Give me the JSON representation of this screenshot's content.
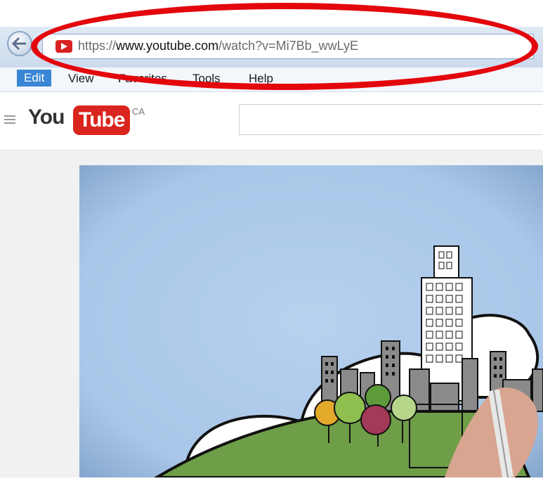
{
  "browser": {
    "url_scheme": "https://",
    "url_domain": "www.youtube.com",
    "url_path": "/watch?v=Mi7Bb_wwLyE"
  },
  "menu": {
    "items": [
      "Edit",
      "View",
      "Favorites",
      "Tools",
      "Help"
    ]
  },
  "youtube": {
    "logo_you": "You",
    "logo_tube": "Tube",
    "country": "CA",
    "search_value": ""
  },
  "colors": {
    "annotation": "#e3060c",
    "youtube_red": "#d9251d",
    "sky": "#a9c6e8",
    "hill": "#6f9e48"
  },
  "icons": [
    "back-arrow-icon",
    "youtube-favicon-icon",
    "hamburger-menu-icon"
  ]
}
